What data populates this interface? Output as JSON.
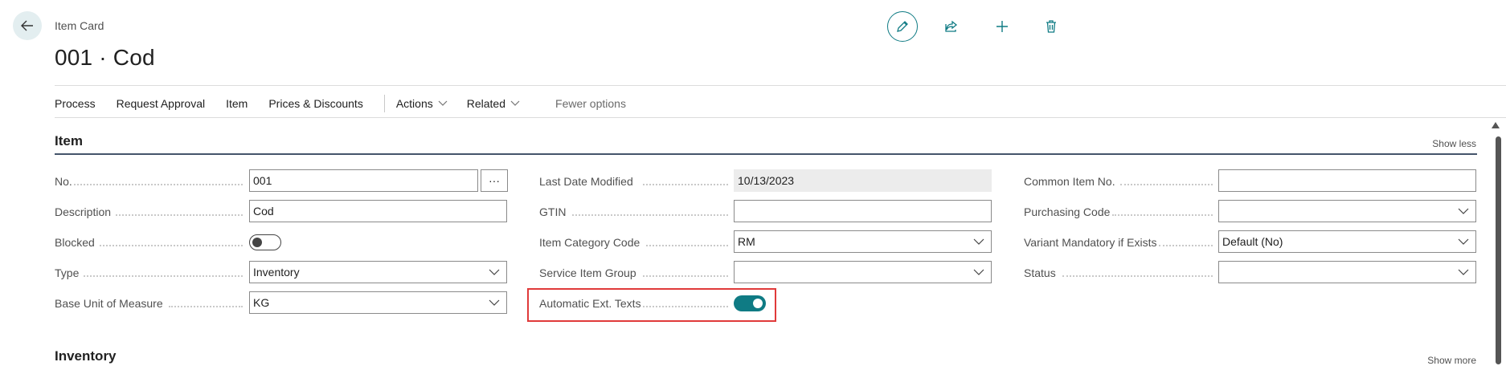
{
  "header": {
    "breadcrumb": "Item Card",
    "title": "001 · Cod"
  },
  "toolbar": {
    "icons": [
      "edit-icon",
      "share-icon",
      "new-icon",
      "delete-icon"
    ],
    "accent": "#0f7b84"
  },
  "actions": {
    "process": "Process",
    "request_approval": "Request Approval",
    "item": "Item",
    "prices_discounts": "Prices & Discounts",
    "actions": "Actions",
    "related": "Related",
    "fewer_options": "Fewer options"
  },
  "section_item": {
    "title": "Item",
    "show_less": "Show less"
  },
  "col1": {
    "no_label": "No.",
    "no_value": "001",
    "ellipsis": "···",
    "description_label": "Description",
    "description_value": "Cod",
    "blocked_label": "Blocked",
    "blocked_on": false,
    "type_label": "Type",
    "type_value": "Inventory",
    "base_uom_label": "Base Unit of Measure",
    "base_uom_value": "KG"
  },
  "col2": {
    "last_modified_label": "Last Date Modified",
    "last_modified_value": "10/13/2023",
    "gtin_label": "GTIN",
    "gtin_value": "",
    "item_category_label": "Item Category Code",
    "item_category_value": "RM",
    "service_item_group_label": "Service Item Group",
    "service_item_group_value": "",
    "auto_ext_texts_label": "Automatic Ext. Texts",
    "auto_ext_texts_on": true
  },
  "col3": {
    "common_item_no_label": "Common Item No.",
    "common_item_no_value": "",
    "purchasing_code_label": "Purchasing Code",
    "purchasing_code_value": "",
    "variant_mandatory_label": "Variant Mandatory if Exists",
    "variant_mandatory_value": "Default (No)",
    "status_label": "Status",
    "status_value": ""
  },
  "section_inventory": {
    "title": "Inventory",
    "show_more": "Show more"
  }
}
